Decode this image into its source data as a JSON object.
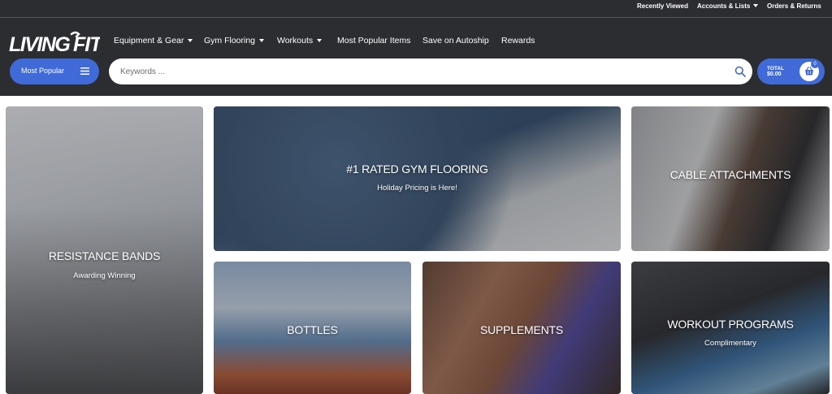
{
  "utility": {
    "recently_viewed": "Recently Viewed",
    "accounts": "Accounts & Lists",
    "orders": "Orders & Returns"
  },
  "brand": {
    "logo_text": "LIVING.FIT"
  },
  "nav": [
    {
      "label": "Equipment & Gear",
      "dropdown": true
    },
    {
      "label": "Gym Flooring",
      "dropdown": true
    },
    {
      "label": "Workouts",
      "dropdown": true
    },
    {
      "label": "Most Popular Items",
      "dropdown": false
    },
    {
      "label": "Save on Autoship",
      "dropdown": false
    },
    {
      "label": "Rewards",
      "dropdown": false
    }
  ],
  "category_button": {
    "label": "Most Popular",
    "icon": "menu-icon"
  },
  "search": {
    "placeholder": "Keywords ...",
    "value": "",
    "icon": "search-icon"
  },
  "cart": {
    "total_label": "TOTAL",
    "total_value": "$0.00",
    "count": "0",
    "icon": "basket-icon"
  },
  "tiles": [
    {
      "title": "RESISTANCE BANDS",
      "subtitle": "Awarding Winning"
    },
    {
      "title": "#1 RATED GYM FLOORING",
      "subtitle": "Holiday Pricing is Here!"
    },
    {
      "title": "CABLE ATTACHMENTS",
      "subtitle": ""
    },
    {
      "title": "BOTTLES",
      "subtitle": ""
    },
    {
      "title": "SUPPLEMENTS",
      "subtitle": ""
    },
    {
      "title": "WORKOUT PROGRAMS",
      "subtitle": "Complimentary"
    }
  ],
  "colors": {
    "header_bg": "#2c2d31",
    "accent": "#3f6ad8",
    "text_light": "#ffffff"
  }
}
